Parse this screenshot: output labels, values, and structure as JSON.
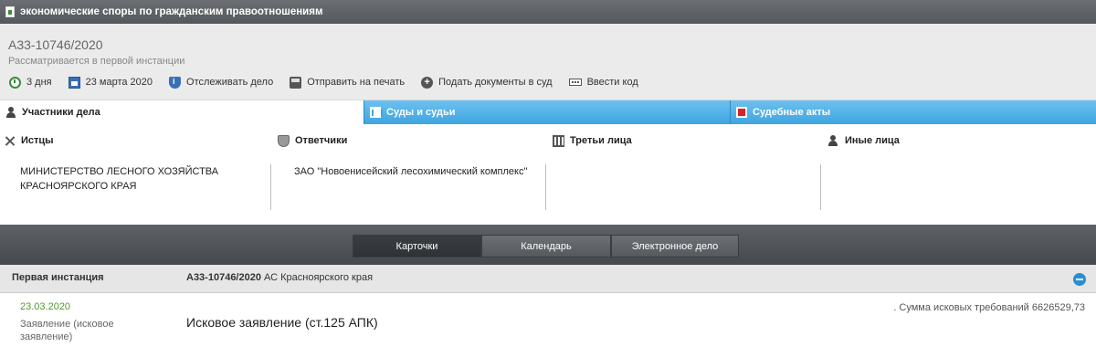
{
  "topbar": {
    "title": "экономические споры по гражданским правоотношениям",
    "icon": "document-icon"
  },
  "header": {
    "case_number": "А33-10746/2020",
    "status": "Рассматривается в первой инстанции",
    "actions": [
      {
        "label": "3 дня",
        "icon": "clock-icon"
      },
      {
        "label": "23 марта 2020",
        "icon": "calendar-icon"
      },
      {
        "label": "Отслеживать дело",
        "icon": "shield-info-icon"
      },
      {
        "label": "Отправить на печать",
        "icon": "printer-icon"
      },
      {
        "label": "Подать документы в суд",
        "icon": "plus-icon"
      },
      {
        "label": "Ввести код",
        "icon": "keyboard-icon"
      }
    ]
  },
  "tabs": [
    {
      "label": "Участники дела",
      "icon": "person-icon"
    },
    {
      "label": "Суды и судьи",
      "icon": "building-icon"
    },
    {
      "label": "Судебные акты",
      "icon": "pdf-icon"
    }
  ],
  "parties": [
    {
      "heading": "Истцы",
      "icon": "swords-icon",
      "body": "МИНИСТЕРСТВО ЛЕСНОГО ХОЗЯЙСТВА КРАСНОЯРСКОГО КРАЯ"
    },
    {
      "heading": "Ответчики",
      "icon": "shield-icon",
      "body": "ЗАО \"Новоенисейский лесохимический комплекс\""
    },
    {
      "heading": "Третьи лица",
      "icon": "fence-icon",
      "body": ""
    },
    {
      "heading": "Иные лица",
      "icon": "person-icon",
      "body": ""
    }
  ],
  "views": [
    {
      "label": "Карточки",
      "active": true
    },
    {
      "label": "Календарь",
      "active": false
    },
    {
      "label": "Электронное дело",
      "active": false
    }
  ],
  "instance": {
    "label": "Первая инстанция",
    "case_number": "А33-10746/2020",
    "court": "АС Красноярского края"
  },
  "entry": {
    "date": "23.03.2020",
    "type": "Заявление (исковое заявление)",
    "title": "Исковое заявление (ст.125 АПК)",
    "sum": ". Сумма исковых требований 6626529,73"
  },
  "colors": {
    "accent_blue": "#3fa4e0",
    "date_green": "#4f9a2c",
    "dark_bar": "#45484c"
  }
}
